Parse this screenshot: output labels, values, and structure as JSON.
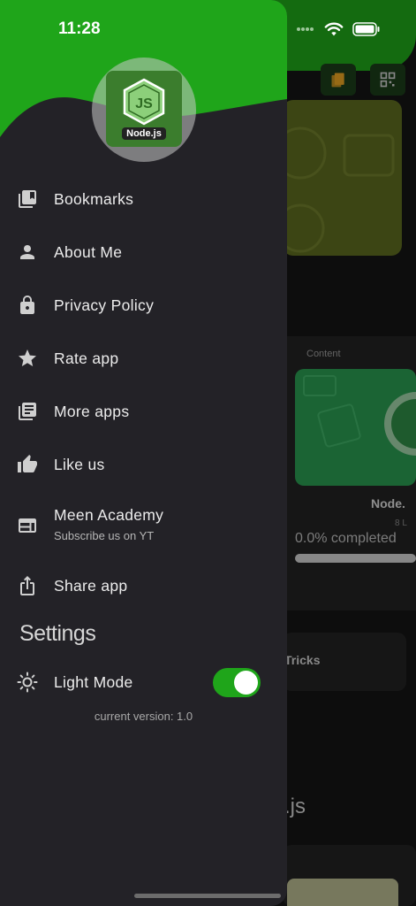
{
  "status_bar": {
    "time": "11:28"
  },
  "drawer": {
    "logo_caption": "Node.js",
    "menu": [
      {
        "label": "Bookmarks",
        "icon": "bookmarks-icon"
      },
      {
        "label": "About Me",
        "icon": "person-icon"
      },
      {
        "label": "Privacy Policy",
        "icon": "lock-icon"
      },
      {
        "label": "Rate app",
        "icon": "star-icon"
      },
      {
        "label": "More apps",
        "icon": "library-icon"
      },
      {
        "label": "Like us",
        "icon": "thumbs-up-icon"
      },
      {
        "label": "Meen Academy",
        "sub": "Subscribe us on YT",
        "icon": "web-window-icon"
      },
      {
        "label": "Share app",
        "icon": "share-icon"
      }
    ],
    "settings_title": "Settings",
    "light_mode": {
      "label": "Light Mode",
      "enabled": true
    },
    "version": "current version: 1.0"
  },
  "background": {
    "content_label": "Content",
    "course_title": "Node.",
    "lessons": "8 L",
    "progress_text": "0.0% completed",
    "progress_fraction": 0.0,
    "tricks_label": "Tricks",
    "js_label": ".js"
  },
  "colors": {
    "brand_green": "#1fa51a",
    "drawer_bg": "#232227",
    "card_green": "#2a9a51"
  }
}
